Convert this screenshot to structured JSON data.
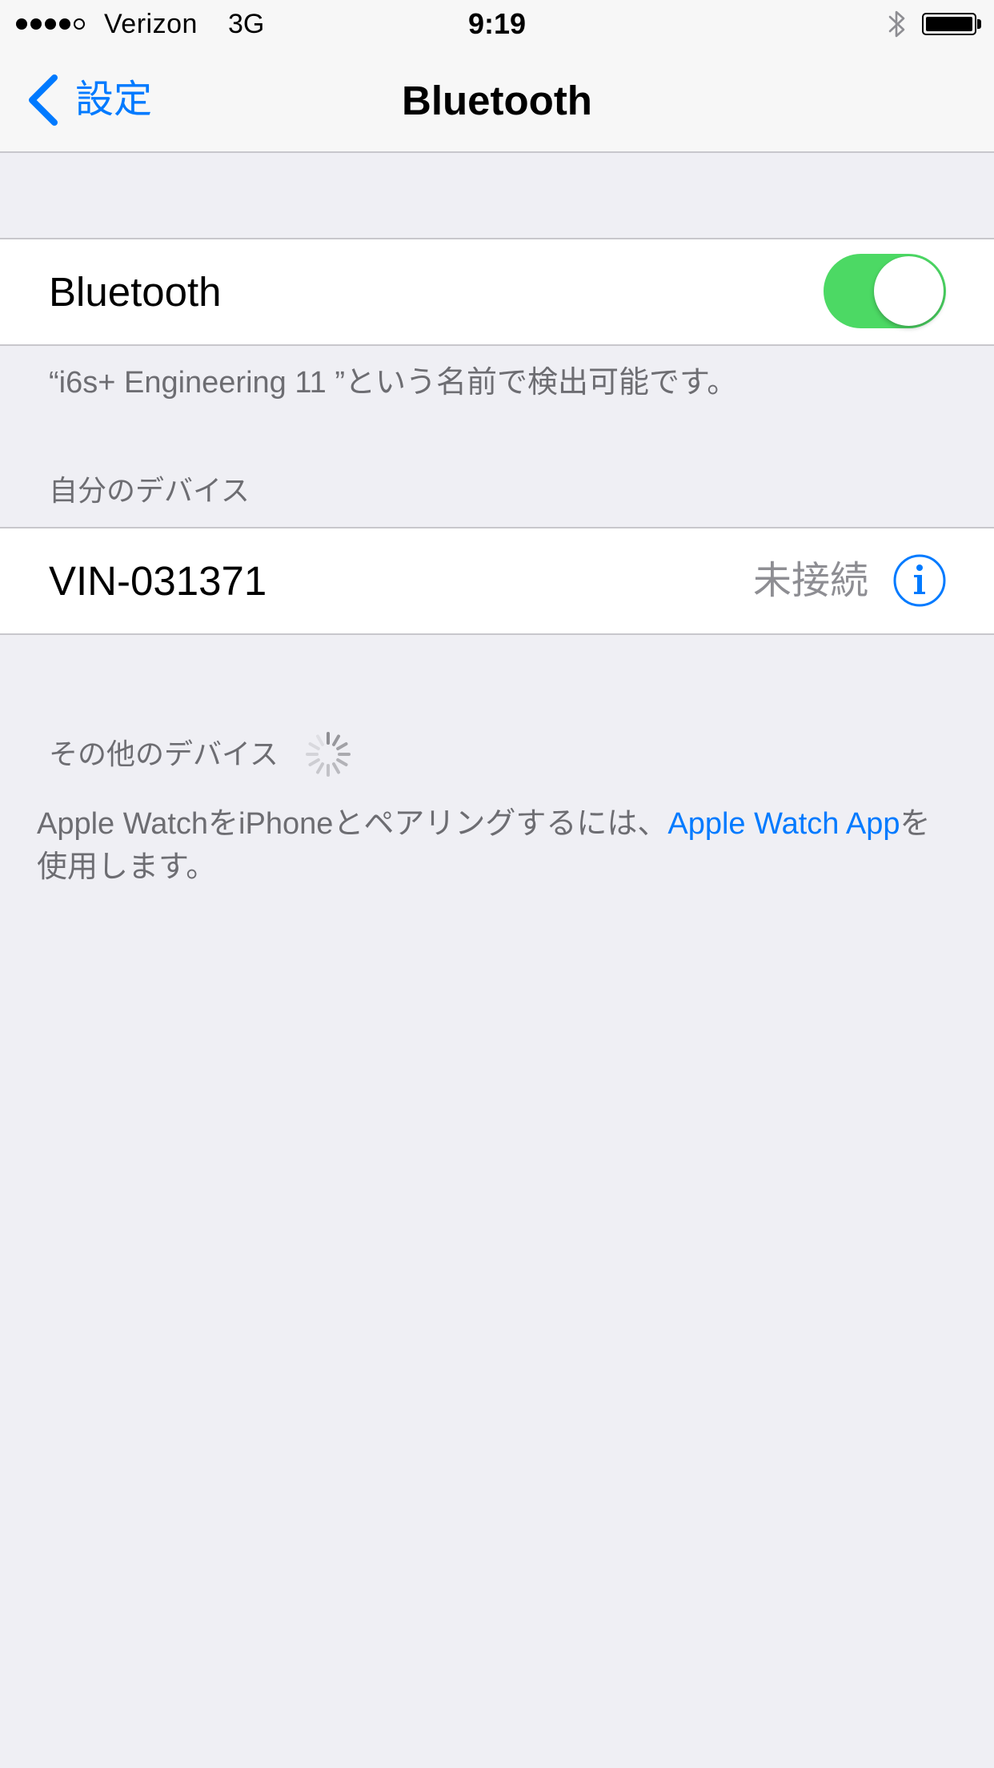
{
  "status_bar": {
    "signal_filled": 4,
    "signal_total": 5,
    "carrier": "Verizon",
    "network": "3G",
    "time": "9:19",
    "bluetooth_icon": "bluetooth-icon",
    "battery_level": 1.0
  },
  "nav": {
    "back_label": "設定",
    "title": "Bluetooth"
  },
  "bluetooth": {
    "label": "Bluetooth",
    "enabled": true,
    "discoverable_note": "“i6s+ Engineering 11 ”という名前で検出可能です。"
  },
  "my_devices": {
    "header": "自分のデバイス",
    "devices": [
      {
        "name": "VIN-031371",
        "status": "未接続"
      }
    ]
  },
  "other_devices": {
    "header": "その他のデバイス",
    "searching": true
  },
  "pairing_note": {
    "prefix": "Apple WatchをiPhoneとペアリングするには、",
    "link": "Apple Watch App",
    "suffix": "を使用します。"
  },
  "colors": {
    "accent": "#007aff",
    "toggle_on": "#4cd964",
    "background": "#efeff4",
    "secondary_text": "#6d6d72"
  }
}
